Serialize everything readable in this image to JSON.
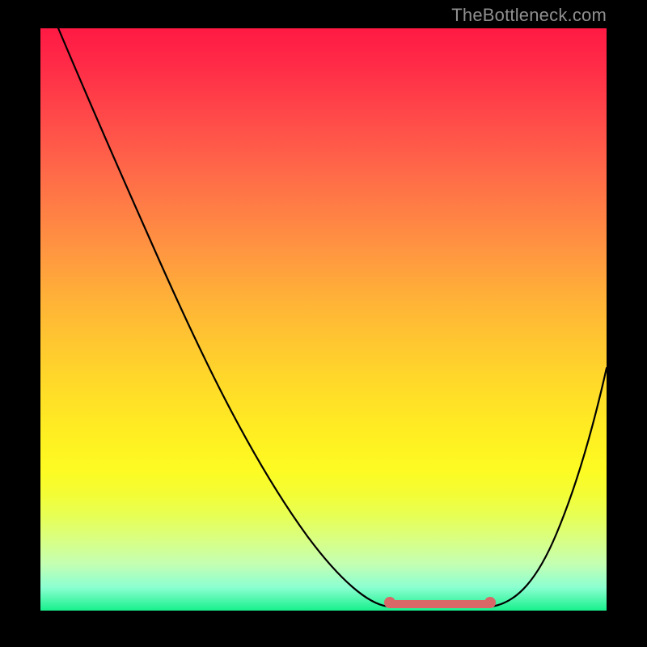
{
  "watermark": "TheBottleneck.com",
  "colors": {
    "background": "#000000",
    "curve": "#000000",
    "highlight": "#d96767",
    "gradient_top": "#ff1a44",
    "gradient_bottom": "#18f08c"
  },
  "chart_data": {
    "type": "line",
    "title": "",
    "xlabel": "",
    "ylabel": "",
    "xlim": [
      0,
      100
    ],
    "ylim": [
      0,
      100
    ],
    "grid": false,
    "legend": false,
    "series": [
      {
        "name": "bottleneck-curve",
        "x": [
          3,
          10,
          19,
          28,
          37,
          47,
          55,
          61.5,
          68,
          74,
          79.5,
          85,
          91,
          100
        ],
        "values": [
          100,
          88,
          76,
          64,
          47,
          29,
          13,
          1,
          0,
          0,
          1,
          9,
          22,
          42
        ]
      }
    ],
    "annotations": [
      {
        "name": "optimal-range",
        "x_start": 61.5,
        "x_end": 79.5,
        "y": 0,
        "color": "#d96767"
      }
    ]
  }
}
